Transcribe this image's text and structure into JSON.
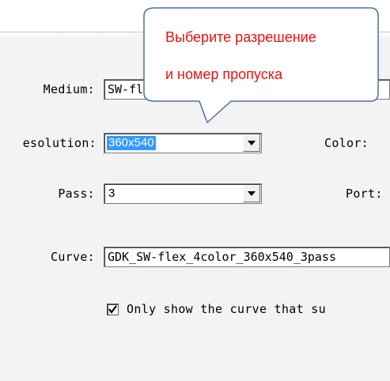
{
  "form": {
    "medium_label": "Medium:",
    "medium_value": "SW-flex",
    "resolution_label": "esolution:",
    "resolution_value": "360x540",
    "color_label": "Color:",
    "pass_label": "Pass:",
    "pass_value": "3",
    "port_label": "Port:",
    "curve_label": "Curve:",
    "curve_value": "GDK_SW-flex_4color_360x540_3pass",
    "only_show_label": "Only show the curve that su",
    "only_show_checked": true
  },
  "callout": {
    "line1": "Выберите разрешение",
    "line2": "и номер пропуска",
    "text_color": "#ee1111",
    "border_color": "#4a6fa5"
  },
  "icons": {
    "dropdown": "chevron-down-icon",
    "checkbox": "checkmark-icon"
  }
}
